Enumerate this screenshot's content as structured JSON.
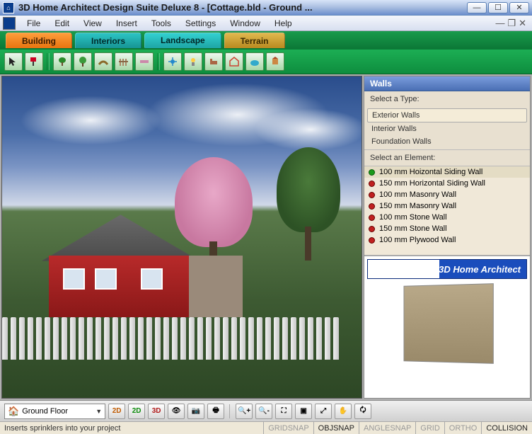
{
  "titlebar": {
    "title": "3D Home Architect Design Suite Deluxe 8 - [Cottage.bld - Ground ..."
  },
  "menu": {
    "file": "File",
    "edit": "Edit",
    "view": "View",
    "insert": "Insert",
    "tools": "Tools",
    "settings": "Settings",
    "window": "Window",
    "help": "Help"
  },
  "tabs": {
    "building": "Building",
    "interiors": "Interiors",
    "landscape": "Landscape",
    "terrain": "Terrain"
  },
  "sidebar": {
    "walls_header": "Walls",
    "select_type": "Select a Type:",
    "types": [
      "Exterior Walls",
      "Interior Walls",
      "Foundation Walls"
    ],
    "selected_type_index": 0,
    "select_element": "Select an Element:",
    "elements": [
      "100 mm Hoizontal Siding Wall",
      "150 mm Horizontal Siding Wall",
      "100 mm Masonry Wall",
      "150 mm Masonry Wall",
      "100 mm Stone Wall",
      "150 mm Stone Wall",
      "100 mm Plywood Wall"
    ],
    "selected_element_index": 0,
    "logo_text": "3D Home Architect"
  },
  "bottombar": {
    "floor_selector": "Ground Floor",
    "btn_2d": "2D",
    "btn_2dg": "2D",
    "btn_3d": "3D"
  },
  "statusbar": {
    "hint": "Inserts sprinklers into your project",
    "cells": [
      "GRIDSNAP",
      "OBJSNAP",
      "ANGLESNAP",
      "GRID",
      "ORTHO",
      "COLLISION"
    ],
    "active_cells": [
      1,
      5
    ]
  }
}
